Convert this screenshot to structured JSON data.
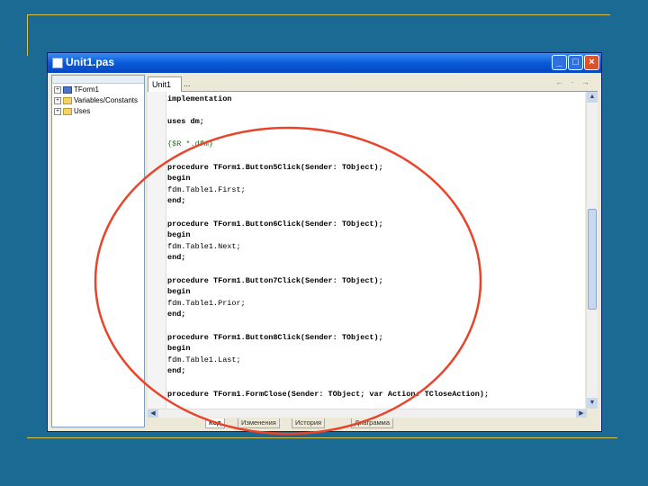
{
  "window": {
    "title": "Unit1.pas"
  },
  "titlebar": {
    "min": "_",
    "max": "□",
    "close": "×"
  },
  "tree": {
    "items": [
      {
        "label": "TForm1",
        "icon": "form-icon"
      },
      {
        "label": "Variables/Constants",
        "icon": "folder-icon"
      },
      {
        "label": "Uses",
        "icon": "folder-icon"
      }
    ]
  },
  "editor": {
    "tabs": [
      "Unit1",
      "..."
    ],
    "nav": "← · →",
    "lines": [
      "implementation",
      "",
      "uses dm;",
      "",
      "{$R *.dfm}",
      "",
      "procedure TForm1.Button5Click(Sender: TObject);",
      "begin",
      "fdm.Table1.First;",
      "end;",
      "",
      "procedure TForm1.Button6Click(Sender: TObject);",
      "begin",
      "fdm.Table1.Next;",
      "end;",
      "",
      "procedure TForm1.Button7Click(Sender: TObject);",
      "begin",
      "fdm.Table1.Prior;",
      "end;",
      "",
      "procedure TForm1.Button8Click(Sender: TObject);",
      "begin",
      "fdm.Table1.Last;",
      "end;",
      "",
      "procedure TForm1.FormClose(Sender: TObject; var Action: TCloseAction);"
    ],
    "line_styles": [
      "kw",
      "",
      "kw",
      "",
      "dir",
      "",
      "kw",
      "kw",
      "",
      "kw",
      "",
      "kw",
      "kw",
      "",
      "kw",
      "",
      "kw",
      "kw",
      "",
      "kw",
      "",
      "kw",
      "kw",
      "",
      "kw",
      "",
      "kw"
    ]
  },
  "bottom_tabs": [
    "Код",
    "Изменения",
    "История",
    "Диаграмма"
  ],
  "colors": {
    "annotation_ellipse": "#e8442a"
  }
}
